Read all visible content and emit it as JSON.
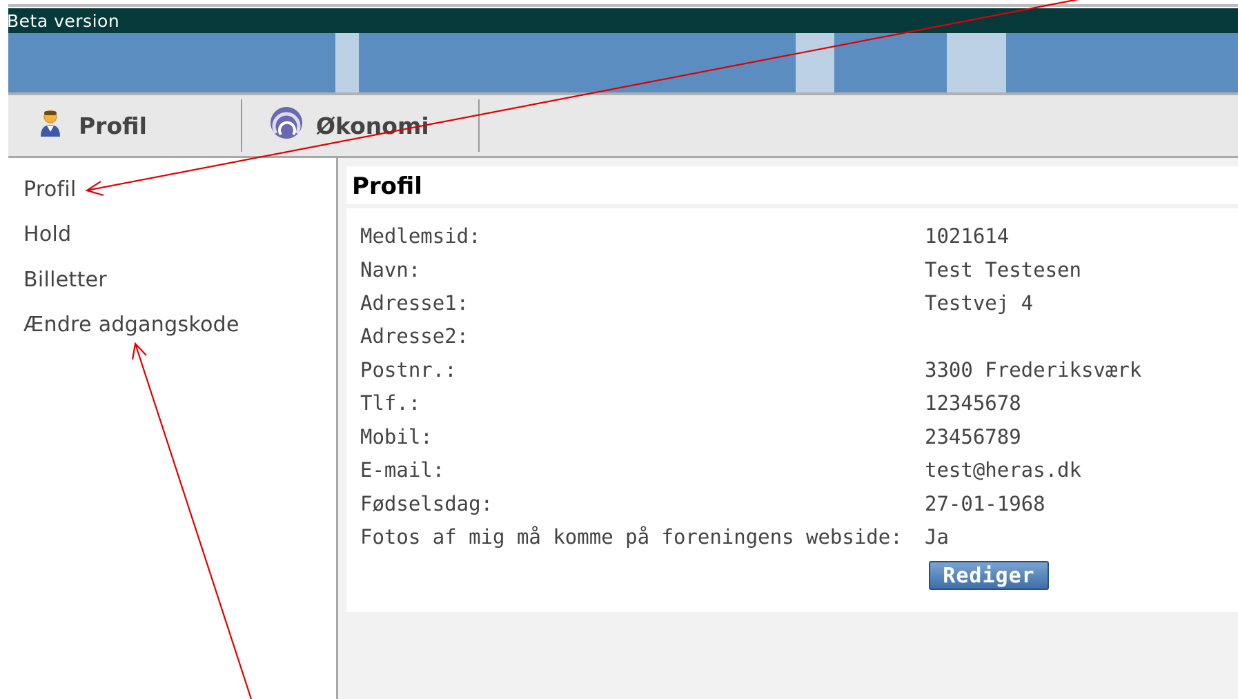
{
  "header": {
    "beta_label": "Beta version"
  },
  "tabs": [
    {
      "label": "Profil",
      "icon": "user-icon"
    },
    {
      "label": "Økonomi",
      "icon": "economy-icon"
    }
  ],
  "sidebar": {
    "items": [
      {
        "label": "Profil"
      },
      {
        "label": "Hold"
      },
      {
        "label": "Billetter"
      },
      {
        "label": "Ændre adgangskode"
      }
    ]
  },
  "profile": {
    "title": "Profil",
    "rows": [
      {
        "label": "Medlemsid:",
        "value": "1021614"
      },
      {
        "label": "Navn:",
        "value": "Test Testesen"
      },
      {
        "label": "Adresse1:",
        "value": "Testvej 4"
      },
      {
        "label": "Adresse2:",
        "value": ""
      },
      {
        "label": "Postnr.:",
        "value": "3300 Frederiksværk"
      },
      {
        "label": "Tlf.:",
        "value": "12345678"
      },
      {
        "label": "Mobil:",
        "value": "23456789"
      },
      {
        "label": "E-mail:",
        "value": "test@heras.dk"
      },
      {
        "label": "Fødselsdag:",
        "value": "27-01-1968"
      },
      {
        "label": "Fotos af mig må komme på foreningens webside:",
        "value": "Ja"
      }
    ],
    "edit_label": "Rediger"
  },
  "colors": {
    "beta_bar": "#05393a",
    "banner": "#5b8dc0",
    "banner_stripe": "#bcd0e4",
    "annotation_arrow": "#e00000",
    "button": "#3d6fa8"
  }
}
